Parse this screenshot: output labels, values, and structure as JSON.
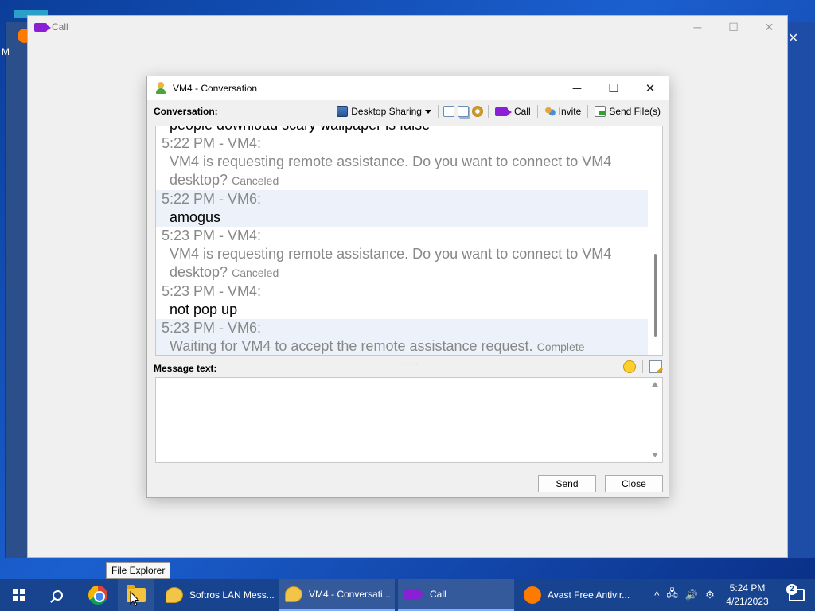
{
  "call_window": {
    "title": "Call",
    "controls": {
      "minimize": "─",
      "maximize": "☐",
      "close": "✕"
    }
  },
  "background": {
    "letter": "M",
    "close": "✕"
  },
  "conversation": {
    "title": "VM4 - Conversation",
    "controls": {
      "minimize": "─",
      "maximize": "☐",
      "close": "✕"
    },
    "toolbar": {
      "label": "Conversation:",
      "desktop_sharing": "Desktop Sharing",
      "call": "Call",
      "invite": "Invite",
      "send_files": "Send File(s)"
    },
    "messages": [
      {
        "header": "5:22 PM - VM4:",
        "body": "VM4 is requesting remote assistance. Do you want to connect to VM4 desktop?",
        "status": "Canceled",
        "style": "gray",
        "alt": false
      },
      {
        "header": "5:22 PM - VM6:",
        "body": "amogus",
        "status": "",
        "style": "dark",
        "alt": true
      },
      {
        "header": "5:23 PM - VM4:",
        "body": "VM4 is requesting remote assistance. Do you want to connect to VM4 desktop?",
        "status": "Canceled",
        "style": "gray",
        "alt": false
      },
      {
        "header": "5:23 PM - VM4:",
        "body": "not pop up",
        "status": "",
        "style": "dark",
        "alt": false
      },
      {
        "header": "5:23 PM - VM6:",
        "body": "Waiting for VM4 to accept the remote assistance request.",
        "status": "Complete",
        "style": "gray",
        "alt": true
      }
    ],
    "partial_top_line": "people download scary wallpaper is false",
    "message_label": "Message text:",
    "message_value": "",
    "send_label": "Send",
    "close_label": "Close",
    "grip": "....."
  },
  "tooltip": "File Explorer",
  "taskbar": {
    "apps": [
      {
        "label": "Softros LAN Mess...",
        "active": false
      },
      {
        "label": "VM4 - Conversati...",
        "active": true
      },
      {
        "label": "Call",
        "active": true
      },
      {
        "label": "Avast Free Antivir...",
        "active": false
      }
    ],
    "tray": {
      "chevron": "^",
      "network": "🖧",
      "volume": "🔊",
      "settings": "⚙"
    },
    "time": "5:24 PM",
    "date": "4/21/2023",
    "notification_count": "2"
  },
  "colors": {
    "taskbar": "#18448f",
    "alt_row": "#edf2fa",
    "call_purple": "#8a1fd6"
  }
}
